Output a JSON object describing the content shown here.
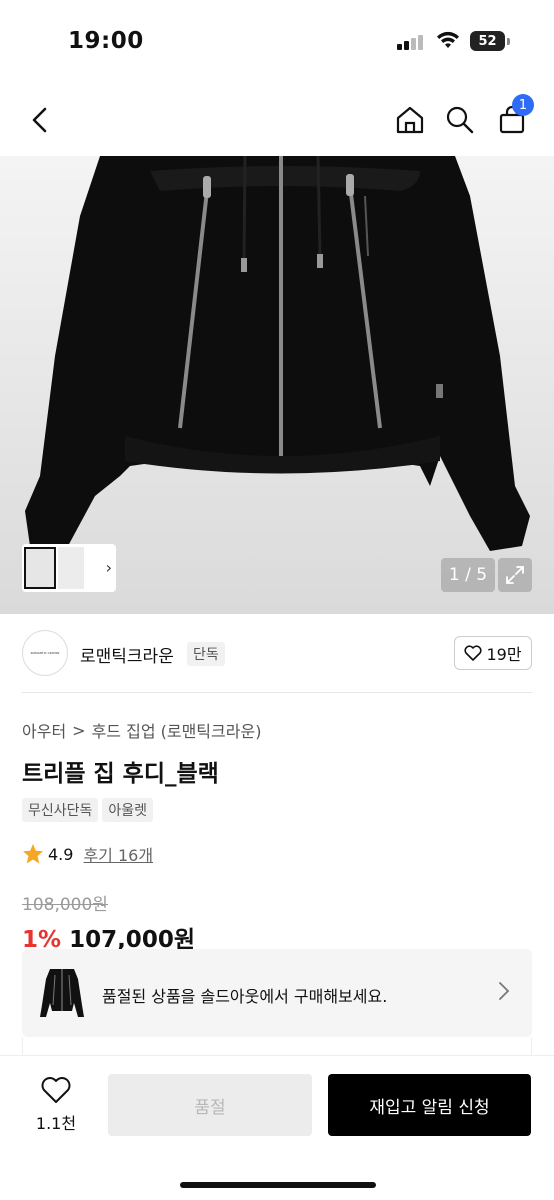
{
  "status": {
    "time": "19:00",
    "battery": "52"
  },
  "nav": {
    "cart_count": "1"
  },
  "gallery": {
    "counter": "1 / 5"
  },
  "brand": {
    "logo_text": "ROMANTIC CROWN",
    "name": "로맨틱크라운",
    "badge": "단독",
    "likes": "19만"
  },
  "breadcrumb": {
    "category": "아우터",
    "separator": ">",
    "subcategory": "후드 집업 (로맨틱크라운)"
  },
  "product": {
    "title": "트리플 집 후디_블랙",
    "tags": [
      "무신사단독",
      "아울렛"
    ],
    "rating": "4.9",
    "reviews": "후기 16개",
    "original_price": "108,000원",
    "discount": "1%",
    "price": "107,000원"
  },
  "soldout_banner": {
    "text": "품절된 상품을 솔드아웃에서 구매해보세요."
  },
  "bottom": {
    "wish_count": "1.1천",
    "soldout_label": "품절",
    "restock_label": "재입고 알림 신청"
  },
  "colors": {
    "accent_blue": "#2f6cf6",
    "discount_red": "#e8342e",
    "cta_black": "#000000"
  },
  "icons": [
    "back-icon",
    "home-icon",
    "search-icon",
    "cart-icon",
    "expand-icon",
    "heart-icon",
    "star-icon",
    "chevron-right-icon"
  ]
}
